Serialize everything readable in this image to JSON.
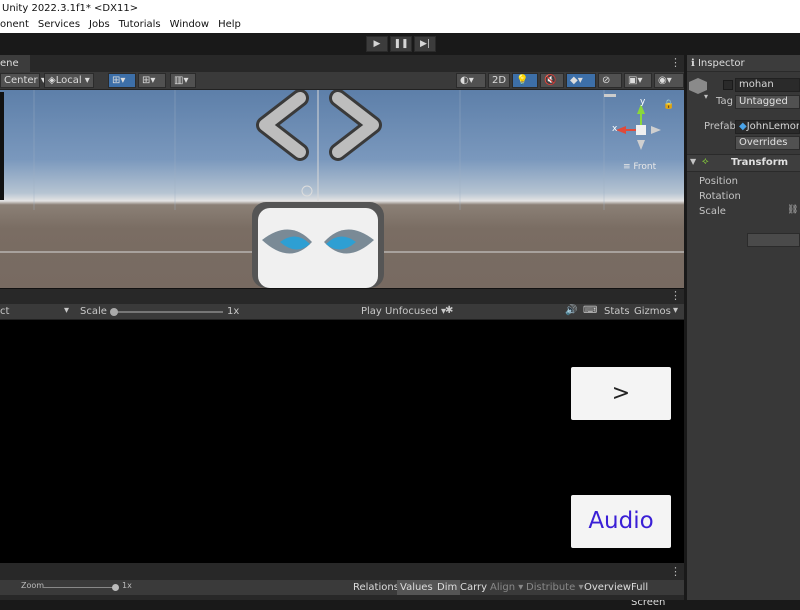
{
  "window": {
    "title": "Unity 2022.3.1f1* <DX11>"
  },
  "menu": [
    "onent",
    "Services",
    "Jobs",
    "Tutorials",
    "Window",
    "Help"
  ],
  "playbar": {
    "play": "▶",
    "pause": "❚❚",
    "step": "▶|"
  },
  "scene": {
    "tab": "ene",
    "pivot_mode": "Center",
    "pivot_space": "Local",
    "mode_2d": "2D",
    "gizmo_label": "Front",
    "gizmo_y": "y",
    "gizmo_x": "x"
  },
  "game": {
    "display_select": "ct",
    "scale_label": "Scale",
    "scale_value": "1x",
    "play_mode": "Play Unfocused",
    "stats": "Stats",
    "gizmos": "Gizmos",
    "next_button": ">",
    "audio_button": "Audio"
  },
  "bottom": {
    "zoom_label": "Zoom",
    "zoom_value": "1x",
    "relations": "Relations",
    "values": "Values",
    "dim": "Dim",
    "carry": "Carry",
    "align": "Align",
    "distribute": "Distribute",
    "overview": "Overview",
    "fullscreen": "Full Screen"
  },
  "inspector": {
    "tab": "Inspector",
    "object_name": "mohan",
    "tag_label": "Tag",
    "tag_value": "Untagged",
    "prefab_label": "Prefab",
    "prefab_value": "JohnLemon",
    "overrides": "Overrides",
    "transform_header": "Transform",
    "position": "Position",
    "rotation": "Rotation",
    "scale": "Scale"
  },
  "colors": {
    "accent": "#3d6fa8",
    "audio_text": "#3a1fd6",
    "panel_bg": "#383838"
  }
}
